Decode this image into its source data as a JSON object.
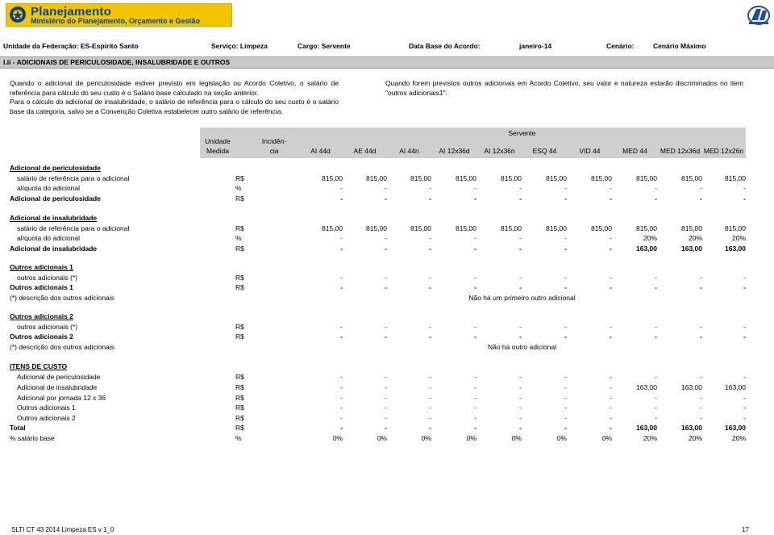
{
  "logo": {
    "line1": "Planejamento",
    "line2": "Ministério do Planejamento, Orçamento e Gestão"
  },
  "header": {
    "uf": "Unidade da Federação: ES-Espirito Santo",
    "servico": "Serviço: Limpeza",
    "cargo": "Cargo: Servente",
    "database_label": "Data Base do Acordo:",
    "database_value": "janeiro-14",
    "cenario_label": "Cenário:",
    "cenario_value": "Cenário Máximo"
  },
  "section_title": "I.ii - ADICIONAIS DE PERICULOSIDADE, INSALUBRIDADE E OUTROS",
  "notes": {
    "left1": "Quando o adicional de periculosidade estiver previsto em legislação ou Acordo Coletivo, o salário de referência para cálculo do seu custo é o Salário base calculado na seção anterior.",
    "left2": "Para o cálculo do adicional de insalubridade, o salário de referência para o cálculo do seu custo é o salário base da categoria, salvo se a Convenção Coletiva estabelecer outro salário de referência.",
    "right": "Quando forem previstos outros adicionais em Acordo Coletivo, seu valor e natureza estarão discriminados no item \"outros adicionais1\"."
  },
  "table": {
    "unit_header_1": "Unidade",
    "unit_header_2": "Medida",
    "inc_header_1": "Incidên-",
    "inc_header_2": "cia",
    "group_header": "Servente",
    "columns": [
      "AI 44d",
      "AE 44d",
      "AI 44n",
      "AI 12x36d",
      "AI 12x36n",
      "ESQ 44",
      "VID 44",
      "MED 44",
      "MED 12x36d",
      "MED 12x26n"
    ],
    "rows": [
      {
        "label": "Adicional de periculosidade",
        "style": "bu",
        "unit": "",
        "values": []
      },
      {
        "label": "salário de referência para o adicional",
        "style": "i",
        "unit": "R$",
        "values": [
          "815,00",
          "815,00",
          "815,00",
          "815,00",
          "815,00",
          "815,00",
          "815,00",
          "815,00",
          "815,00",
          "815,00"
        ]
      },
      {
        "label": "alíquota do adicional",
        "style": "i",
        "unit": "%",
        "values": [
          "-",
          "-",
          "-",
          "-",
          "-",
          "-",
          "-",
          "-",
          "-",
          "-"
        ]
      },
      {
        "label": "Adicional de periculosidade",
        "style": "b",
        "unit": "R$",
        "values": [
          "-",
          "-",
          "-",
          "-",
          "-",
          "-",
          "-",
          "-",
          "-",
          "-"
        ]
      },
      {
        "label": "Adicional de insalubridade",
        "style": "bu",
        "unit": "",
        "values": []
      },
      {
        "label": "salário de referência para o adicional",
        "style": "i",
        "unit": "R$",
        "values": [
          "815,00",
          "815,00",
          "815,00",
          "815,00",
          "815,00",
          "815,00",
          "815,00",
          "815,00",
          "815,00",
          "815,00"
        ]
      },
      {
        "label": "alíquota do adicional",
        "style": "i",
        "unit": "%",
        "values": [
          "-",
          "-",
          "-",
          "-",
          "-",
          "-",
          "-",
          "20%",
          "20%",
          "20%"
        ]
      },
      {
        "label": "Adicional de insalubridade",
        "style": "b",
        "unit": "R$",
        "values": [
          "-",
          "-",
          "-",
          "-",
          "-",
          "-",
          "-",
          "163,00",
          "163,00",
          "163,00"
        ]
      },
      {
        "label": "Outros adicionais 1",
        "style": "bu",
        "unit": "",
        "values": []
      },
      {
        "label": "outros adicionais (*)",
        "style": "i",
        "unit": "R$",
        "values": [
          "-",
          "-",
          "-",
          "-",
          "-",
          "-",
          "-",
          "-",
          "-",
          "-"
        ]
      },
      {
        "label": "Outros adicionais 1",
        "style": "b",
        "unit": "R$",
        "values": [
          "-",
          "-",
          "-",
          "-",
          "-",
          "-",
          "-",
          "-",
          "-",
          "-"
        ]
      },
      {
        "label": "(*) descrição dos outros adicionais",
        "style": "n",
        "unit": "",
        "values": [],
        "note": "Não há um primeiro outro adicional"
      },
      {
        "label": "Outros adicionais 2",
        "style": "bu",
        "unit": "",
        "values": []
      },
      {
        "label": "outros adicionais (*)",
        "style": "i",
        "unit": "R$",
        "values": [
          "-",
          "-",
          "-",
          "-",
          "-",
          "-",
          "-",
          "-",
          "-",
          "-"
        ]
      },
      {
        "label": "Outros adicionais 2",
        "style": "b",
        "unit": "R$",
        "values": [
          "-",
          "-",
          "-",
          "-",
          "-",
          "-",
          "-",
          "-",
          "-",
          "-"
        ]
      },
      {
        "label": "(*) descrição dos outros adicionais",
        "style": "n",
        "unit": "",
        "values": [],
        "note": "Não há outro adicional"
      },
      {
        "label": "ITENS DE CUSTO",
        "style": "bu",
        "unit": "",
        "values": []
      },
      {
        "label": "Adicional de periculosidade",
        "style": "i",
        "unit": "R$",
        "values": [
          "-",
          "-",
          "-",
          "-",
          "-",
          "-",
          "-",
          "-",
          "-",
          "-"
        ]
      },
      {
        "label": "Adicional de insalubridade",
        "style": "i",
        "unit": "R$",
        "values": [
          "-",
          "-",
          "-",
          "-",
          "-",
          "-",
          "-",
          "163,00",
          "163,00",
          "163,00"
        ]
      },
      {
        "label": "Adicional por jornada 12 x 36",
        "style": "i",
        "unit": "R$",
        "values": [
          "-",
          "-",
          "-",
          "-",
          "-",
          "-",
          "-",
          "-",
          "-",
          "-"
        ]
      },
      {
        "label": "Outros adicionais 1",
        "style": "i",
        "unit": "R$",
        "values": [
          "-",
          "-",
          "-",
          "-",
          "-",
          "-",
          "-",
          "-",
          "-",
          "-"
        ]
      },
      {
        "label": "Outros adicionais 2",
        "style": "i",
        "unit": "R$",
        "values": [
          "-",
          "-",
          "-",
          "-",
          "-",
          "-",
          "-",
          "-",
          "-",
          "-"
        ]
      },
      {
        "label": "Total",
        "style": "b",
        "unit": "R$",
        "values": [
          "-",
          "-",
          "-",
          "-",
          "-",
          "-",
          "-",
          "163,00",
          "163,00",
          "163,00"
        ]
      },
      {
        "label": "% salário base",
        "style": "n",
        "unit": "%",
        "values": [
          "0%",
          "0%",
          "0%",
          "0%",
          "0%",
          "0%",
          "0%",
          "20%",
          "20%",
          "20%"
        ]
      }
    ]
  },
  "footer": {
    "left": "SLTI CT 43 2014 Limpeza ES v 1_0",
    "right": "17"
  }
}
